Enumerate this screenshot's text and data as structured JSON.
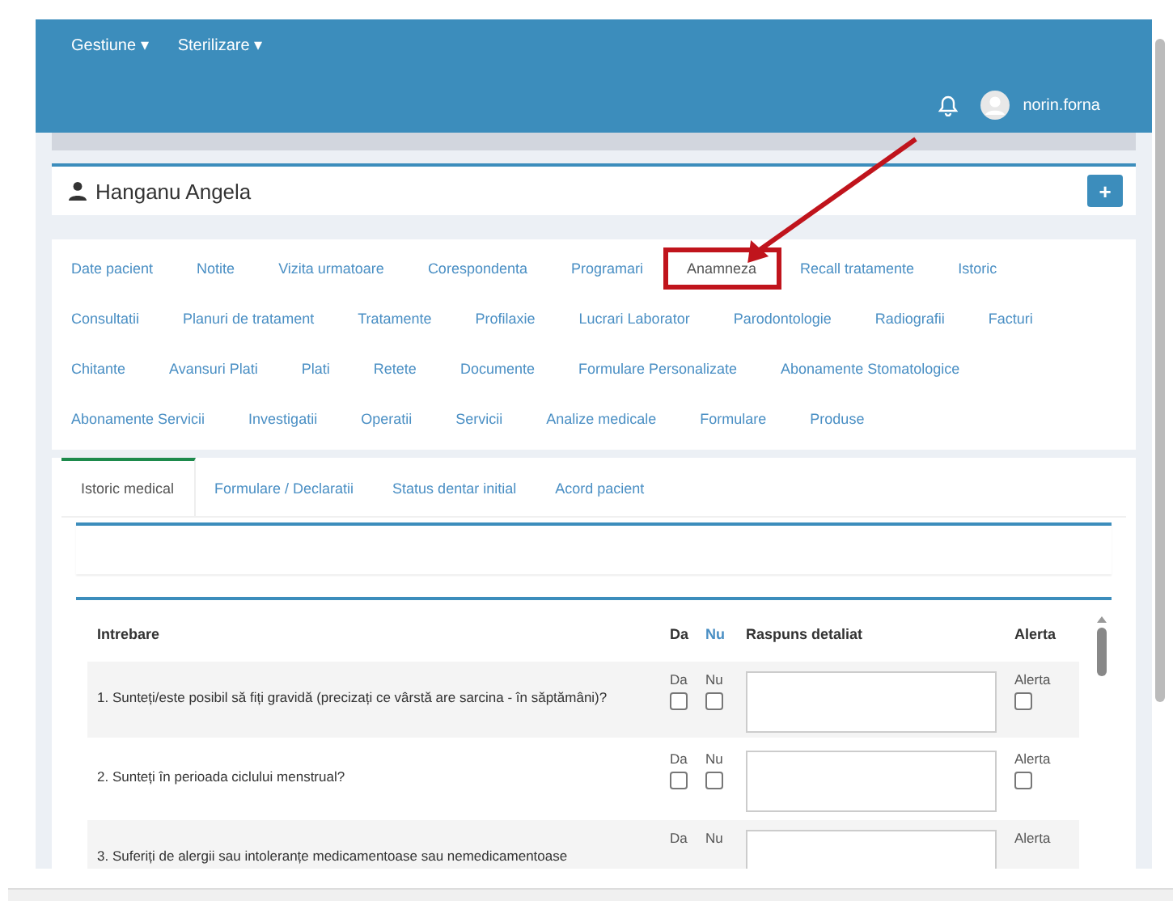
{
  "navbar": {
    "menus": [
      {
        "label": "Gestiune",
        "caret": "▾"
      },
      {
        "label": "Sterilizare",
        "caret": "▾"
      }
    ],
    "user": "norin.forna"
  },
  "patient": {
    "name": "Hanganu Angela",
    "add_button": "+"
  },
  "tab_rows": [
    [
      {
        "label": "Date pacient",
        "selected": false,
        "highlighted": false
      },
      {
        "label": "Notite",
        "selected": false,
        "highlighted": false
      },
      {
        "label": "Vizita urmatoare",
        "selected": false,
        "highlighted": false
      },
      {
        "label": "Corespondenta",
        "selected": false,
        "highlighted": false
      },
      {
        "label": "Programari",
        "selected": false,
        "highlighted": false
      },
      {
        "label": "Anamneza",
        "selected": true,
        "highlighted": true
      },
      {
        "label": "Recall tratamente",
        "selected": false,
        "highlighted": false
      },
      {
        "label": "Istoric",
        "selected": false,
        "highlighted": false
      }
    ],
    [
      {
        "label": "Consultatii",
        "selected": false,
        "highlighted": false
      },
      {
        "label": "Planuri de tratament",
        "selected": false,
        "highlighted": false
      },
      {
        "label": "Tratamente",
        "selected": false,
        "highlighted": false
      },
      {
        "label": "Profilaxie",
        "selected": false,
        "highlighted": false
      },
      {
        "label": "Lucrari Laborator",
        "selected": false,
        "highlighted": false
      },
      {
        "label": "Parodontologie",
        "selected": false,
        "highlighted": false
      },
      {
        "label": "Radiografii",
        "selected": false,
        "highlighted": false
      },
      {
        "label": "Facturi",
        "selected": false,
        "highlighted": false
      }
    ],
    [
      {
        "label": "Chitante",
        "selected": false,
        "highlighted": false
      },
      {
        "label": "Avansuri Plati",
        "selected": false,
        "highlighted": false
      },
      {
        "label": "Plati",
        "selected": false,
        "highlighted": false
      },
      {
        "label": "Retete",
        "selected": false,
        "highlighted": false
      },
      {
        "label": "Documente",
        "selected": false,
        "highlighted": false
      },
      {
        "label": "Formulare Personalizate",
        "selected": false,
        "highlighted": false
      },
      {
        "label": "Abonamente Stomatologice",
        "selected": false,
        "highlighted": false
      }
    ],
    [
      {
        "label": "Abonamente Servicii",
        "selected": false,
        "highlighted": false
      },
      {
        "label": "Investigatii",
        "selected": false,
        "highlighted": false
      },
      {
        "label": "Operatii",
        "selected": false,
        "highlighted": false
      },
      {
        "label": "Servicii",
        "selected": false,
        "highlighted": false
      },
      {
        "label": "Analize medicale",
        "selected": false,
        "highlighted": false
      },
      {
        "label": "Formulare",
        "selected": false,
        "highlighted": false
      },
      {
        "label": "Produse",
        "selected": false,
        "highlighted": false
      }
    ]
  ],
  "sub_tabs": [
    {
      "label": "Istoric medical",
      "selected": true
    },
    {
      "label": "Formulare / Declaratii",
      "selected": false
    },
    {
      "label": "Status dentar initial",
      "selected": false
    },
    {
      "label": "Acord pacient",
      "selected": false
    }
  ],
  "table": {
    "columns": [
      "Intrebare",
      "Da",
      "Nu",
      "Raspuns detaliat",
      "Alerta"
    ],
    "rows": [
      {
        "question": "1. Sunteți/este posibil să fiți gravidă (precizați ce vârstă are sarcina - în săptămâni)?",
        "da_label": "Da",
        "da": false,
        "nu_label": "Nu",
        "nu": false,
        "alert_label": "Alerta",
        "alert": false
      },
      {
        "question": "2. Sunteți în perioada ciclului menstrual?",
        "da_label": "Da",
        "da": false,
        "nu_label": "Nu",
        "nu": false,
        "alert_label": "Alerta",
        "alert": false
      },
      {
        "question": "3. Suferiți de alergii sau intoleranțe medicamentoase sau nemedicamentoase",
        "da_label": "Da",
        "nu_label": "Nu",
        "alert_label": "Alerta"
      }
    ]
  }
}
